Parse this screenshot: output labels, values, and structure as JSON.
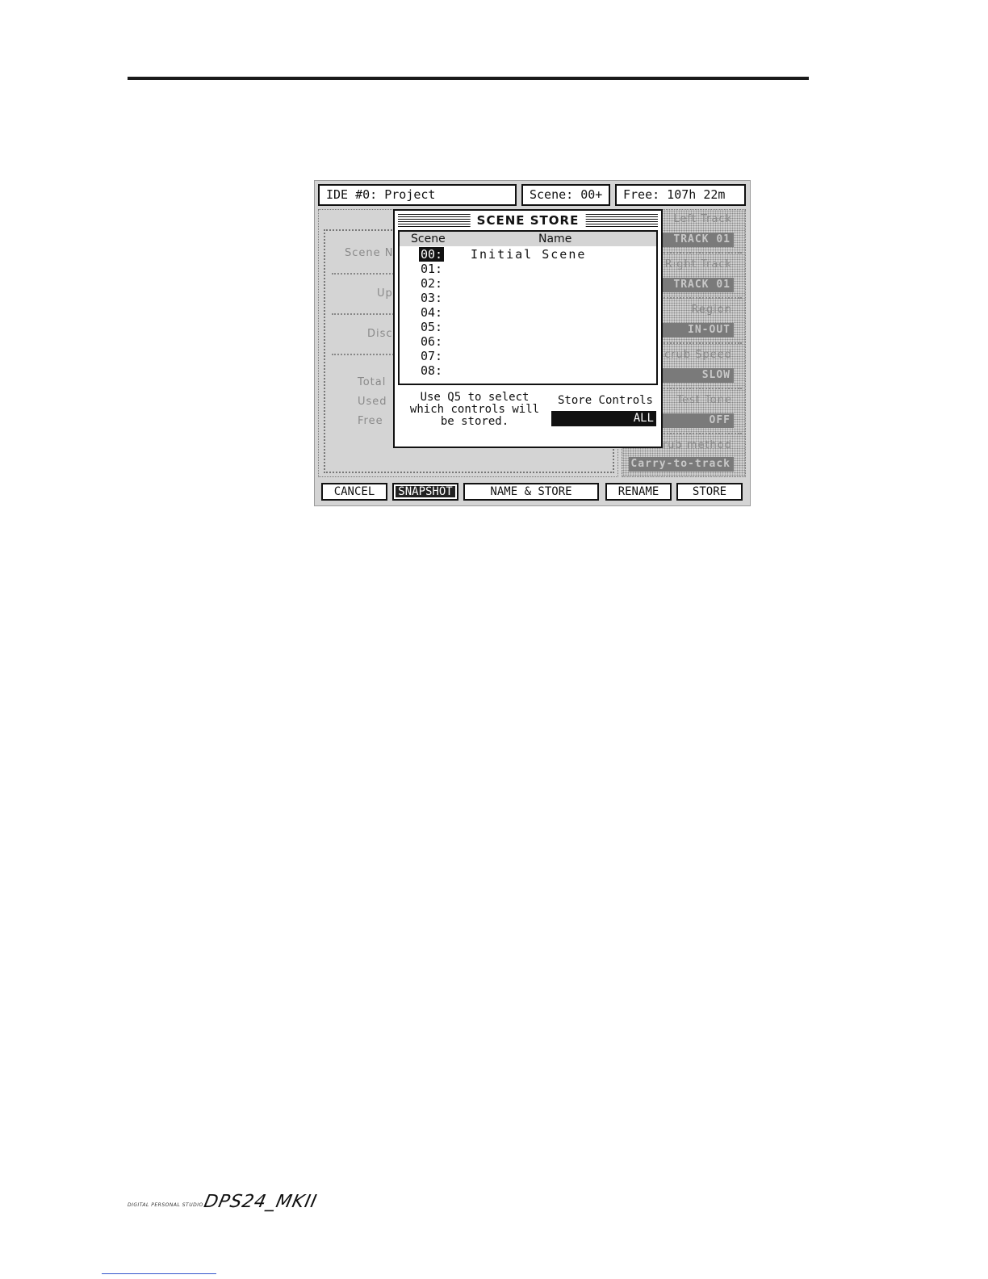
{
  "header": {
    "project": "IDE #0: Project",
    "scene": "Scene: 00+",
    "free": "Free: 107h 22m"
  },
  "background_left": {
    "labels": [
      "Scene N",
      "Up",
      "Disc",
      "Total",
      "Used",
      "Free"
    ]
  },
  "background_right": {
    "items": [
      {
        "label": "Left Track",
        "value": "TRACK 01"
      },
      {
        "label": "Right Track",
        "value": "TRACK 01"
      },
      {
        "label": "Region",
        "value": "IN-OUT"
      },
      {
        "label": "Scrub Speed",
        "value": "SLOW"
      },
      {
        "label": "Test Tone",
        "value": "OFF"
      },
      {
        "label": "Scrub method",
        "value": "Carry-to-track"
      }
    ]
  },
  "dialog": {
    "title": "SCENE STORE",
    "col_scene": "Scene",
    "col_name": "Name",
    "rows": [
      {
        "num": "00:",
        "name": "Initial Scene"
      },
      {
        "num": "01:",
        "name": ""
      },
      {
        "num": "02:",
        "name": ""
      },
      {
        "num": "03:",
        "name": ""
      },
      {
        "num": "04:",
        "name": ""
      },
      {
        "num": "05:",
        "name": ""
      },
      {
        "num": "06:",
        "name": ""
      },
      {
        "num": "07:",
        "name": ""
      },
      {
        "num": "08:",
        "name": ""
      }
    ],
    "help_line1": "Use Q5 to select",
    "help_line2": "which controls will",
    "help_line3": "be stored.",
    "store_controls_label": "Store Controls",
    "store_controls_value": "ALL"
  },
  "softkeys": {
    "cancel": "CANCEL",
    "snapshot": "SNAPSHOT",
    "name_store": "NAME & STORE",
    "rename": "RENAME",
    "store": "STORE"
  },
  "footer": {
    "small": "DIGITAL PERSONAL STUDIO",
    "logo": "DPS24_MKII"
  }
}
